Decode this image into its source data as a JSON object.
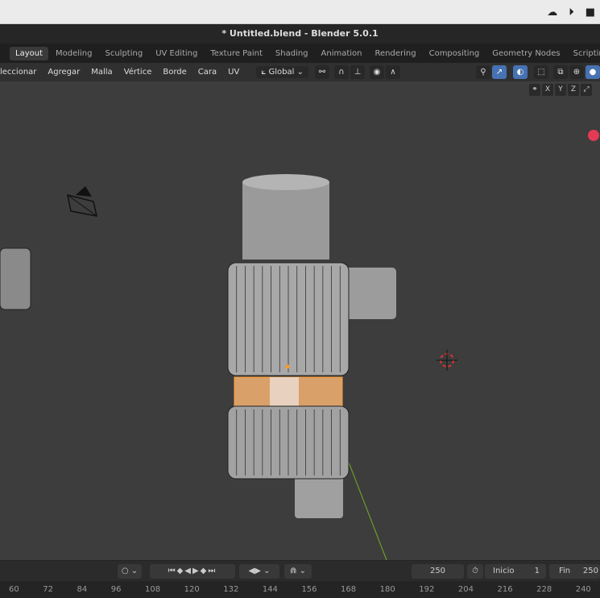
{
  "os": {
    "icons": [
      "creative-cloud-icon",
      "play-circle-icon",
      "stop-icon"
    ]
  },
  "title": "* Untitled.blend - Blender 5.0.1",
  "tabs": [
    "Layout",
    "Modeling",
    "Sculpting",
    "UV Editing",
    "Texture Paint",
    "Shading",
    "Animation",
    "Rendering",
    "Compositing",
    "Geometry Nodes",
    "Scripting",
    "+"
  ],
  "menus": [
    "leccionar",
    "Agregar",
    "Malla",
    "Vértice",
    "Borde",
    "Cara",
    "UV"
  ],
  "transform_orientation": "Global",
  "axes": [
    "X",
    "Y",
    "Z"
  ],
  "colors": {
    "accent": "#4772b3",
    "selection": "#ffa033",
    "viewport": "#3d3d3d"
  },
  "timeline": {
    "current_frame": "250",
    "start_label": "Inicio",
    "start": "1",
    "end_label": "Fin",
    "end": "250"
  },
  "ruler": [
    "60",
    "72",
    "84",
    "96",
    "108",
    "120",
    "132",
    "144",
    "156",
    "168",
    "180",
    "192",
    "204",
    "216",
    "228",
    "240"
  ]
}
